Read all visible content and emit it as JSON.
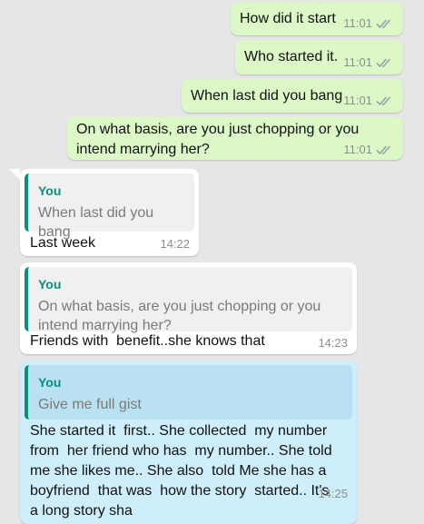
{
  "chat": {
    "outgoing": [
      {
        "text": "How did it start",
        "time": "11:01"
      },
      {
        "text": "Who started it.",
        "time": "11:01"
      },
      {
        "text": "When last did you bang",
        "time": "11:01"
      },
      {
        "text": "On what basis, are you just chopping or you intend marrying her?",
        "time": "11:01"
      }
    ],
    "incoming": [
      {
        "quote_author": "You",
        "quote_text": "When last did you bang",
        "text": "Last week",
        "time": "14:22"
      },
      {
        "quote_author": "You",
        "quote_text": "On what basis, are you just chopping or you intend marrying her?",
        "text": "Friends with  benefit..she knows that",
        "time": "14:23"
      },
      {
        "quote_author": "You",
        "quote_text": "Give me full gist",
        "text": "She started it  first.. She collected  my number from  her friend who has  my number.. She told me she likes me.. She also  told Me she has a boyfriend  that was  how the story  started.. It's  a long story sha",
        "time": "14:25"
      }
    ]
  },
  "colors": {
    "chat_background": "#e6e6e6",
    "outgoing_bubble": "#dcf8c6",
    "incoming_bubble": "#ffffff",
    "selected_bubble": "#cfeefc",
    "quote_accent": "#08907c",
    "read_ticks": "#9aa0a6"
  },
  "icons": {
    "delivered": "double-check-icon"
  }
}
